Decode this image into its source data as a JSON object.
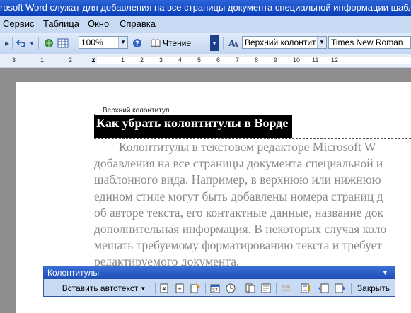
{
  "window": {
    "title": "rosoft Word служат для добавления на все страницы документа специальной информации шабл"
  },
  "menu": {
    "items": [
      "Сервис",
      "Таблица",
      "Окно",
      "Справка"
    ]
  },
  "toolbar": {
    "zoom": "100%",
    "reading_label": "Чтение",
    "style_value": "Верхний колонтит",
    "font_value": "Times New Roman"
  },
  "ruler": {
    "numbers": [
      "3",
      "1",
      "2",
      "1",
      "1",
      "2",
      "3",
      "4",
      "5",
      "6",
      "7",
      "8",
      "9",
      "10",
      "11",
      "12"
    ]
  },
  "document": {
    "header_label": "Верхний колонтитул",
    "heading": "Как убрать колонтитулы в Ворде",
    "lines": [
      "        Колонтитулы в текстовом редакторе Microsoft W",
      "добавления на все страницы документа специальной и",
      "шаблонного вида. Например, в верхнюю или нижнюю",
      "едином стиле могут быть добавлены номера страниц д",
      "об авторе текста, его контактные данные, название док",
      "дополнительная информация. В некоторых случая коло",
      "мешать требуемому форматированию текста и требует",
      "редактируемого документа."
    ]
  },
  "hf_toolbar": {
    "title": "Колонтитулы",
    "insert_autotext": "Вставить автотекст",
    "close": "Закрыть"
  }
}
